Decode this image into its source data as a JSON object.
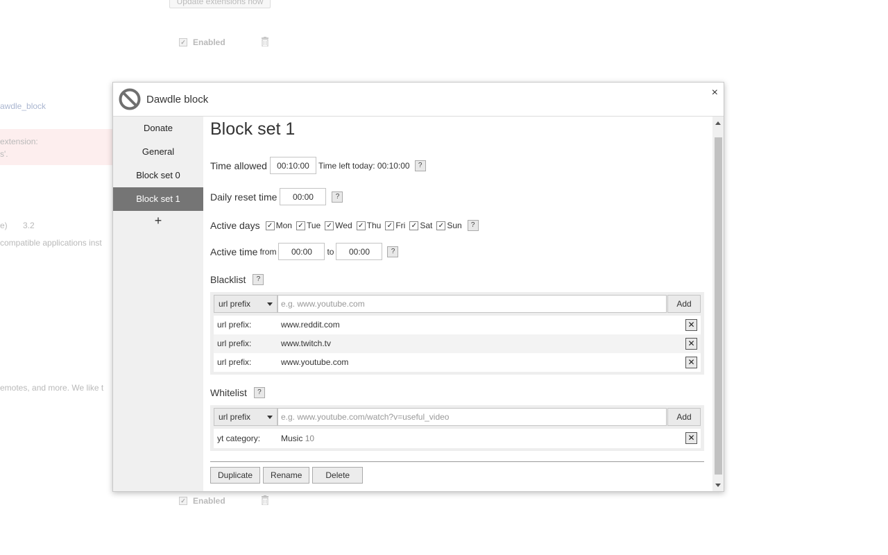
{
  "background": {
    "update_button": "Update extensions now",
    "enabled_label": "Enabled",
    "ext_id_fragment": "awdle_block",
    "error_line1": "extension:",
    "error_line2": "s'.",
    "version_prefix": "e)",
    "version": "3.2",
    "compat_text": "compatible applications inst",
    "desc_text": "emotes, and more. We like t",
    "enabled_label_bottom": "Enabled"
  },
  "dialog": {
    "title": "Dawdle block",
    "close_glyph": "×"
  },
  "sidebar": {
    "items": [
      {
        "label": "Donate"
      },
      {
        "label": "General"
      },
      {
        "label": "Block set 0"
      },
      {
        "label": "Block set 1"
      }
    ],
    "add_label": "+"
  },
  "blockset": {
    "heading": "Block set 1",
    "time_allowed_label": "Time allowed",
    "time_allowed_value": "00:10:00",
    "time_left_text": "Time left today: 00:10:00",
    "reset_label": "Daily reset time",
    "reset_value": "00:00",
    "active_days_label": "Active days",
    "days": [
      {
        "label": "Mon",
        "checked": true
      },
      {
        "label": "Tue",
        "checked": true
      },
      {
        "label": "Wed",
        "checked": true
      },
      {
        "label": "Thu",
        "checked": true
      },
      {
        "label": "Fri",
        "checked": true
      },
      {
        "label": "Sat",
        "checked": true
      },
      {
        "label": "Sun",
        "checked": true
      }
    ],
    "active_time_label": "Active time",
    "from_label": "from",
    "from_value": "00:00",
    "to_label": "to",
    "to_value": "00:00",
    "help_glyph": "?"
  },
  "blacklist": {
    "label": "Blacklist",
    "select_value": "url prefix",
    "placeholder": "e.g. www.youtube.com",
    "add_label": "Add",
    "entries": [
      {
        "type": "url prefix:",
        "value": "www.reddit.com"
      },
      {
        "type": "url prefix:",
        "value": "www.twitch.tv"
      },
      {
        "type": "url prefix:",
        "value": "www.youtube.com"
      }
    ]
  },
  "whitelist": {
    "label": "Whitelist",
    "select_value": "url prefix",
    "placeholder": "e.g. www.youtube.com/watch?v=useful_video",
    "add_label": "Add",
    "entries": [
      {
        "type": "yt category:",
        "value": "Music",
        "id": "10"
      }
    ]
  },
  "actions": {
    "duplicate": "Duplicate",
    "rename": "Rename",
    "delete": "Delete"
  },
  "colors": {
    "active_nav": "#757575",
    "sidebar_bg": "#f0f0f0",
    "list_bg": "#eeeeee"
  }
}
